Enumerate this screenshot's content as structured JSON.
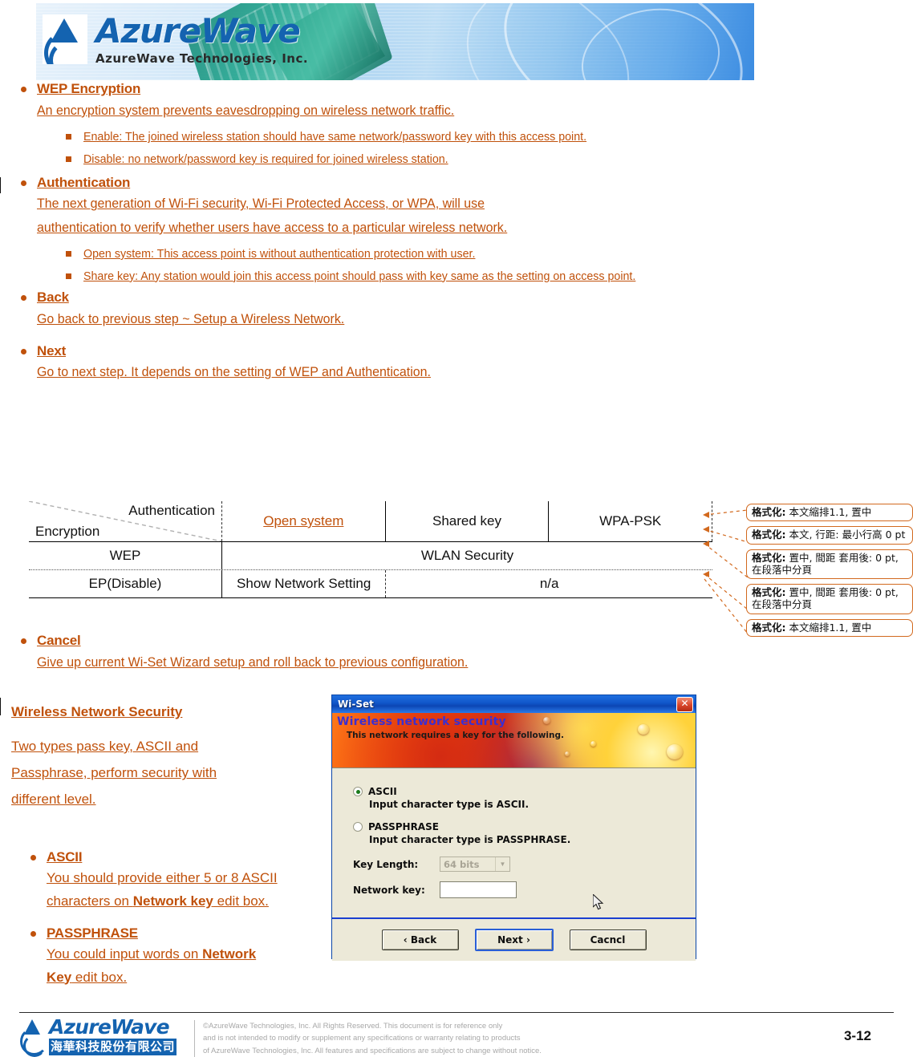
{
  "header": {
    "brand_main": "AzureWave",
    "brand_sub": "AzureWave  Technologies,  Inc."
  },
  "content": {
    "sections": [
      {
        "heading": "WEP Encryption",
        "body": "An encryption system prevents eavesdropping on wireless network traffic. ",
        "subitems": [
          "Enable: The joined wireless station should have same network/password key with this access point.",
          "Disable: no network/password key is required for joined wireless station."
        ]
      },
      {
        "heading": "Authentication",
        "body_line1": "The next generation of Wi-Fi security, Wi-Fi Protected Access, or WPA, will use ",
        "body_line2": "authentication to verify whether users have access to a particular wireless network.",
        "subitems": [
          "Open system: This access point is without authentication protection with user.",
          "Share key: Any station would join this access point should pass with key same as the setting on access point."
        ]
      },
      {
        "heading": "Back",
        "body": "Go back to previous step ~ Setup a Wireless Network."
      },
      {
        "heading": "Next",
        "body": "Go to next step. It depends on the setting of WEP and Authentication."
      },
      {
        "heading": "Cancel",
        "body": "Give up current Wi-Set Wizard setup and roll back to previous configuration. "
      }
    ]
  },
  "comparison_table": {
    "corner_top_label": "Authentication",
    "corner_bottom_label": "Encryption",
    "columns": [
      "Open system",
      "Shared key",
      "WPA-PSK"
    ],
    "rows": [
      {
        "label": "WEP",
        "cells": [
          "WLAN Security"
        ]
      },
      {
        "label": "EP(Disable)",
        "cells": [
          "Show Network Setting",
          "n/a"
        ]
      }
    ]
  },
  "format_callouts": [
    {
      "label": "格式化:",
      "value": "本文縮排1.1, 置中"
    },
    {
      "label": "格式化:",
      "value": "本文, 行距: 最小行高 0 pt"
    },
    {
      "label": "格式化:",
      "value": "置中, 間距 套用後: 0 pt, 在段落中分頁"
    },
    {
      "label": "格式化:",
      "value": "置中, 間距 套用後: 0 pt, 在段落中分頁"
    },
    {
      "label": "格式化:",
      "value": "本文縮排1.1, 置中"
    }
  ],
  "lower_left": {
    "heading": "Wireless Network Security",
    "body_line1": "Two types pass key, ASCII and ",
    "body_line2": "Passphrase, perform security with ",
    "body_line3": "different level.",
    "items": [
      {
        "heading": "ASCII",
        "text_a": "You should provide either 5 or 8 ASCII ",
        "text_b": "characters on ",
        "bold": "Network key",
        "text_c": " edit box."
      },
      {
        "heading": "PASSPHRASE",
        "text_a": "You could input words on ",
        "bold1": "Network ",
        "bold2": "Key",
        "text_c": " edit box."
      }
    ]
  },
  "dialog": {
    "title": "Wi-Set",
    "close_glyph": "✕",
    "banner_title": "Wireless network security",
    "banner_subtitle": "This network requires a key for the following.",
    "options": [
      {
        "label": "ASCII",
        "description": "Input character type is ASCII.",
        "selected": true
      },
      {
        "label": "PASSPHRASE",
        "description": "Input character type is PASSPHRASE.",
        "selected": false
      }
    ],
    "key_length_label": "Key Length:",
    "key_length_value": "64 bits",
    "key_length_disabled": true,
    "network_key_label": "Network key:",
    "network_key_value": "",
    "buttons": {
      "back": "‹ Back",
      "next": "Next ›",
      "cancel": "Cacncl"
    }
  },
  "footer": {
    "brand_main": "AzureWave",
    "brand_cn": "海華科技股份有限公司",
    "copyright_line1": "©AzureWave Technologies, Inc. All Rights Reserved. This document is for reference only",
    "copyright_line2": "and is not intended to modify or supplement any specifications or  warranty relating to products",
    "copyright_line3": "of AzureWave Technologies, Inc.  All features and specifications are subject to change without notice.",
    "page_number": "3-12"
  }
}
